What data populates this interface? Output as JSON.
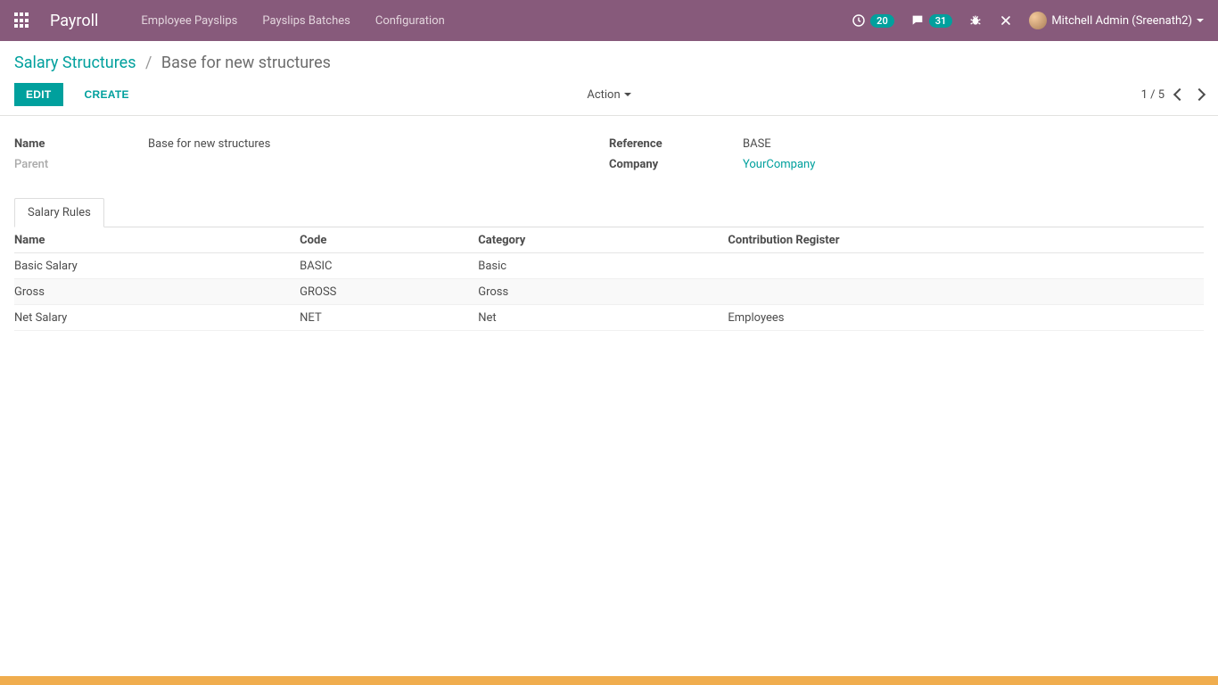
{
  "colors": {
    "accent": "#00a09d",
    "brand": "#875a7b",
    "warn_bar": "#f0ad4e"
  },
  "navbar": {
    "brand": "Payroll",
    "menu": [
      "Employee Payslips",
      "Payslips Batches",
      "Configuration"
    ],
    "user_label": "Mitchell Admin (Sreenath2)",
    "activities_count": "20",
    "messages_count": "31"
  },
  "breadcrumb": {
    "parent": "Salary Structures",
    "current": "Base for new structures"
  },
  "buttons": {
    "edit": "EDIT",
    "create": "CREATE",
    "action": "Action"
  },
  "pager": {
    "text": "1 / 5"
  },
  "form": {
    "name_label": "Name",
    "name_value": "Base for new structures",
    "parent_label": "Parent",
    "parent_value": "",
    "reference_label": "Reference",
    "reference_value": "BASE",
    "company_label": "Company",
    "company_value": "YourCompany"
  },
  "tab": {
    "salary_rules": "Salary Rules"
  },
  "rules_table": {
    "headers": {
      "name": "Name",
      "code": "Code",
      "category": "Category",
      "register": "Contribution Register"
    },
    "rows": [
      {
        "name": "Basic Salary",
        "code": "BASIC",
        "category": "Basic",
        "register": ""
      },
      {
        "name": "Gross",
        "code": "GROSS",
        "category": "Gross",
        "register": ""
      },
      {
        "name": "Net Salary",
        "code": "NET",
        "category": "Net",
        "register": "Employees"
      }
    ]
  }
}
